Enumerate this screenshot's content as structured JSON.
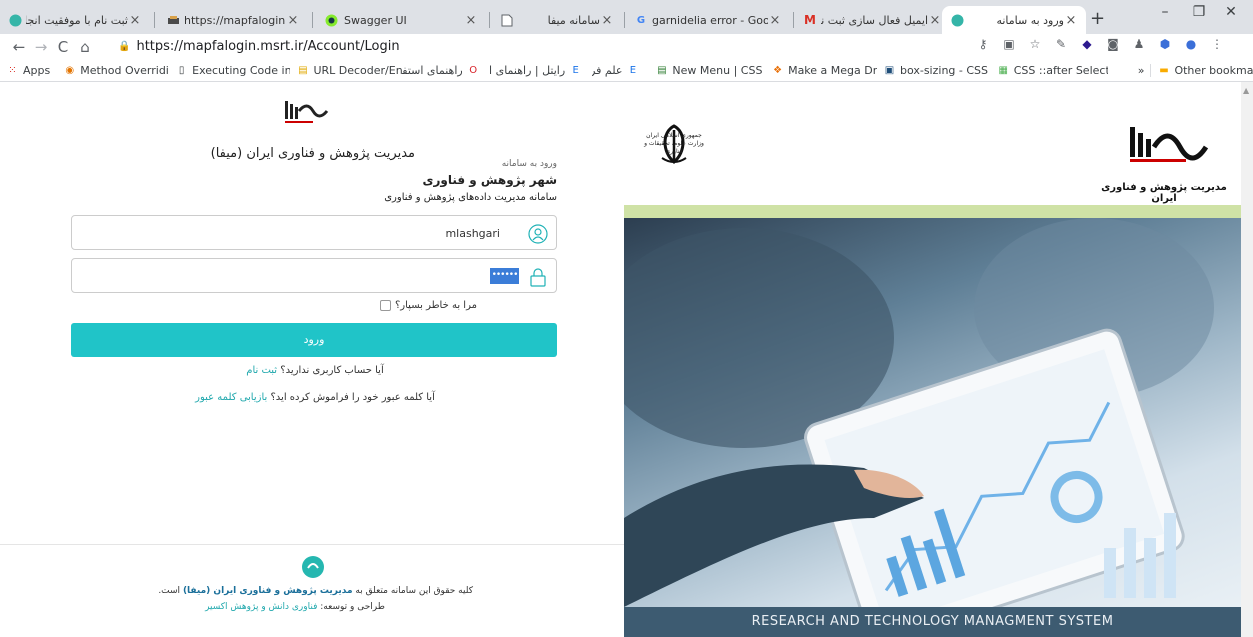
{
  "browser": {
    "tabs": [
      {
        "title": "ثبت نام با موفقیت انجام شد",
        "icon": "mapfa-favicon"
      },
      {
        "title": "https://mapfalogin.msrt.ir",
        "icon": "avatar-favicon"
      },
      {
        "title": "Swagger UI",
        "icon": "swagger-favicon"
      },
      {
        "title": "سامانه میفا",
        "icon": "blank-page-favicon"
      },
      {
        "title": "garnidelia error - Google",
        "icon": "google-favicon"
      },
      {
        "title": "ایمیل فعال سازی ثبت نام",
        "icon": "gmail-favicon"
      },
      {
        "title": "ورود به سامانه",
        "icon": "mapfa-favicon"
      }
    ],
    "address": "https://mapfalogin.msrt.ir/Account/Login",
    "bookmarks": [
      {
        "label": "Apps",
        "icon": "apps-grid-icon"
      },
      {
        "label": "Method Overriding in",
        "icon": "bookmark-favicon"
      },
      {
        "label": "Executing Code in As",
        "icon": "page-icon"
      },
      {
        "label": "URL Decoder/Encode",
        "icon": "bookmark-favicon"
      },
      {
        "label": "راهنمای استفاده از ...",
        "icon": "opera-icon"
      },
      {
        "label": "رایتل | راهنمای استفاده",
        "icon": "bookmark-favicon"
      },
      {
        "label": "علم فردا",
        "icon": "bookmark-favicon"
      },
      {
        "label": "New Menu | CSS Men",
        "icon": "bookmark-favicon"
      },
      {
        "label": "Make a Mega Drop-C",
        "icon": "bookmark-favicon"
      },
      {
        "label": "box-sizing - CSS | MD",
        "icon": "bookmark-favicon"
      },
      {
        "label": "CSS ::after Selector",
        "icon": "bookmark-favicon"
      }
    ],
    "more_bookmarks": "»",
    "other_bookmarks": "Other bookmarks",
    "apps_label": "Apps"
  },
  "login": {
    "org_title": "مدیریت پژوهش و فناوری ایران (میفا)",
    "enter_to": "ورود به سامانه",
    "city_title": "شهر پژوهش و فناوری",
    "system_subtitle": "سامانه مدیریت داده‌های پژوهش و فناوری",
    "username_value": "mlashgari",
    "password_mask": "••••••",
    "remember_label": "مرا به خاطر بسپار؟",
    "login_button": "ورود",
    "no_account_text": "آیا حساب کاربری ندارید؟",
    "register_link": "ثبت نام",
    "forgot_text": "آیا کلمه عبور خود را فراموش کرده اید؟",
    "recover_link": "بازیابی کلمه عبور"
  },
  "footer": {
    "copyright_prefix": "کلیه حقوق این سامانه متعلق به",
    "copyright_org": "مدیریت پژوهش و فناوری ایران (میفا)",
    "copyright_suffix": "است.",
    "designed_prefix": "طراحی و توسعه:",
    "designed_by": "فناوری دانش و پژوهش اکسیر"
  },
  "hero": {
    "banner": "RESEARCH AND TECHNOLOGY MANAGMENT SYSTEM",
    "brand_name": "مدیریت پژوهش و فناوری ایران",
    "brand_logo_text": "میفا",
    "emblem_caption": "جمهوری اسلامی ایران\nوزارت علوم، تحقیقات و فناوری",
    "emblem_caption_line1": "جمهوری اسلامی ایران",
    "emblem_caption_line2": "وزارت علوم، تحقیقات و فناوری"
  },
  "colors": {
    "accent": "#20c4c8",
    "link": "#20a8ad",
    "banner_bg": "#3d5b71",
    "green_bar": "#cfe2a6"
  }
}
